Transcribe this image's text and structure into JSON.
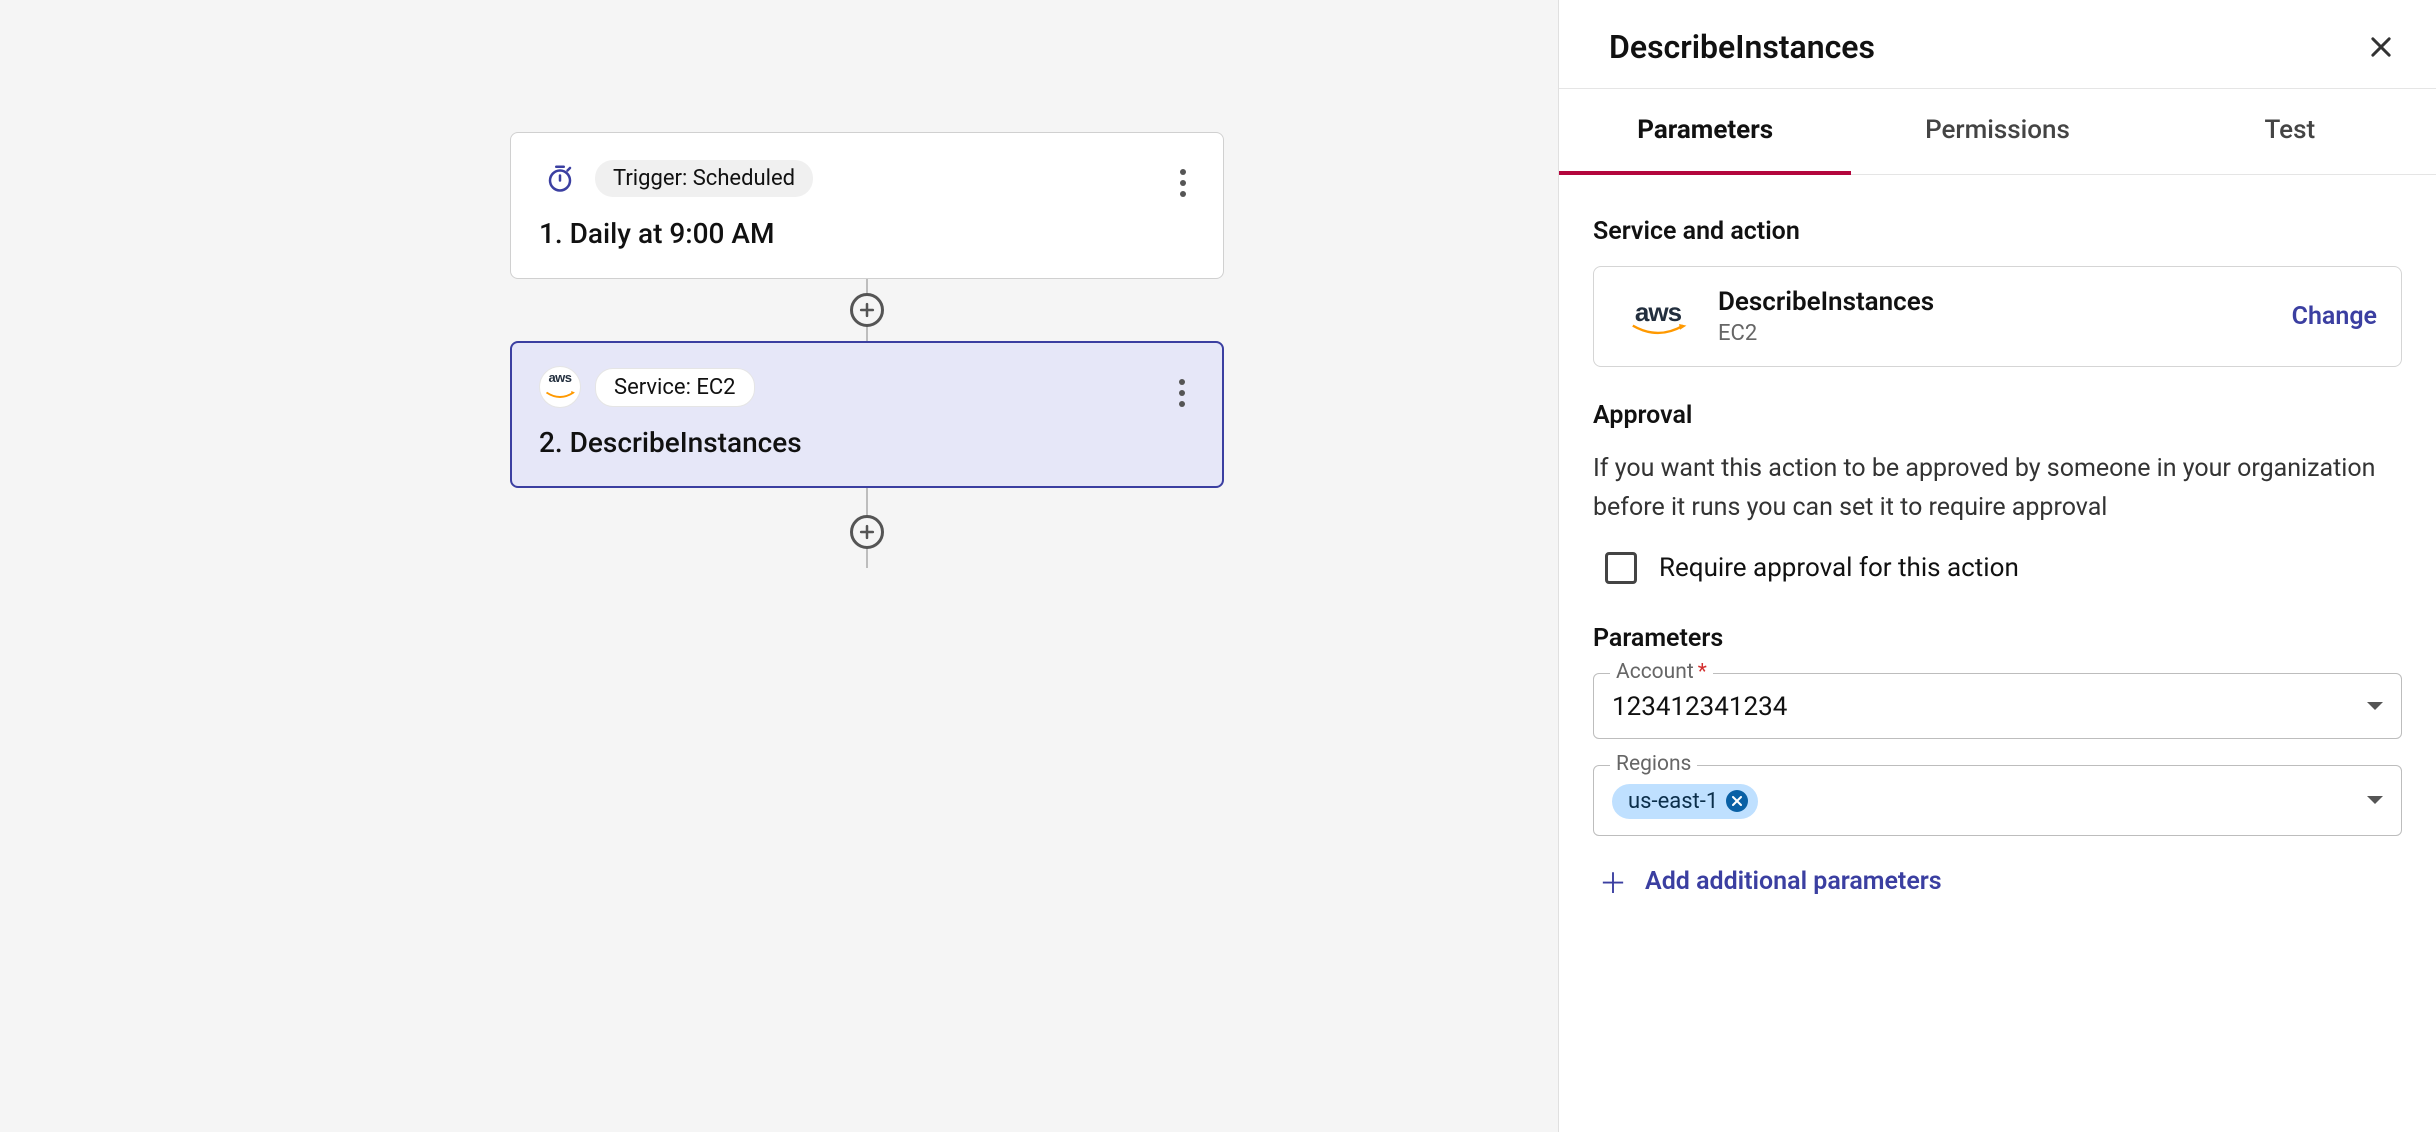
{
  "canvas": {
    "node1": {
      "icon": "timer-icon",
      "pill": "Trigger: Scheduled",
      "title": "1. Daily at 9:00 AM"
    },
    "node2": {
      "icon": "aws-icon",
      "pill": "Service: EC2",
      "title": "2. DescribeInstances"
    }
  },
  "panel": {
    "title": "DescribeInstances",
    "tabs": {
      "parameters": "Parameters",
      "permissions": "Permissions",
      "test": "Test"
    },
    "service_section_title": "Service and action",
    "service_card": {
      "name": "DescribeInstances",
      "sub": "EC2",
      "change": "Change"
    },
    "approval": {
      "title": "Approval",
      "help": "If you want this action to be approved by someone in your organization before it runs you can set it to require approval",
      "checkbox_label": "Require approval for this action",
      "checked": false
    },
    "params": {
      "title": "Parameters",
      "account": {
        "label": "Account",
        "required": true,
        "value": "123412341234"
      },
      "regions": {
        "label": "Regions",
        "chips": [
          "us-east-1"
        ]
      },
      "add_label": "Add additional parameters"
    }
  }
}
